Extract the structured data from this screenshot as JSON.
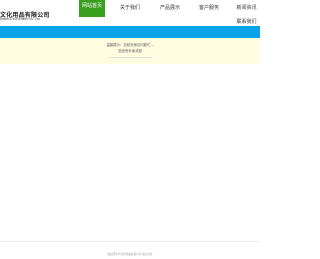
{
  "header": {
    "logo_zh": "文化用品有限公司",
    "logo_en": "WENHUA STATIONERY CO., LTD"
  },
  "nav": {
    "items": [
      {
        "label": "网站首页"
      },
      {
        "label": "关于我们"
      },
      {
        "label": "产品展示"
      },
      {
        "label": "客户服务"
      },
      {
        "label": "新闻资讯"
      },
      {
        "label": "联系我们"
      }
    ],
    "active_index": 0
  },
  "notice": {
    "line1": "温馨提示：当前页面访问繁忙...",
    "line2": "您还有未读消息"
  },
  "footer": {
    "text": "版权所有©文化用品有限公司  技术支持"
  },
  "colors": {
    "nav_active": "#3a9e1f",
    "banner": "#0aa2e8",
    "notice_bg": "#fffde0"
  }
}
